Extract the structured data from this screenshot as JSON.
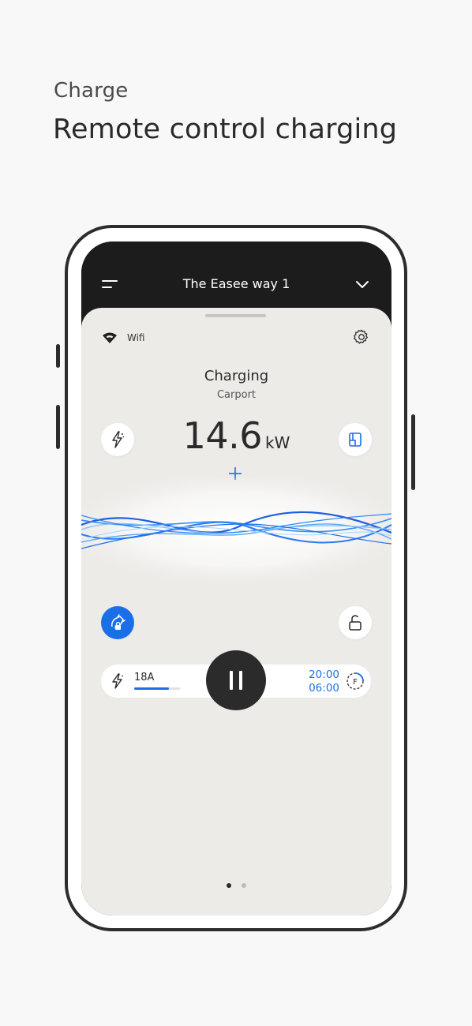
{
  "header": {
    "eyebrow": "Charge",
    "headline": "Remote control charging"
  },
  "app": {
    "site_name": "The Easee way 1",
    "connection": {
      "icon": "wifi-icon",
      "label": "Wifi"
    },
    "status": "Charging",
    "location": "Carport",
    "power": {
      "value": "14.6",
      "unit": "kW"
    },
    "controls": {
      "current_label": "18A",
      "current_fraction": 0.75,
      "schedule_start": "20:00",
      "schedule_end": "06:00",
      "schedule_icon_letter": "F"
    },
    "pager": {
      "total": 2,
      "active": 0
    },
    "colors": {
      "accent": "#1a6fe8",
      "dark": "#1c1c1c",
      "panel": "#ecebe8"
    }
  }
}
